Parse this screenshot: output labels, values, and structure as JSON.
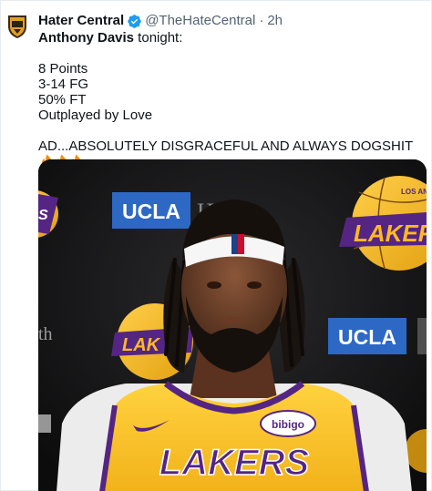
{
  "author": {
    "display_name": "Hater Central",
    "handle": "@TheHateCentral",
    "separator": "·",
    "time": "2h",
    "avatar_icon": "shield-crest-icon",
    "verified_icon": "verified-badge-icon"
  },
  "tweet": {
    "lead_bold": "Anthony Davis",
    "lead_rest": " tonight:",
    "stats": [
      "8 Points",
      "3-14 FG",
      "50% FT",
      "Outplayed by Love"
    ],
    "closing": "AD...ABSOLUTELY DISGRACEFUL AND ALWAYS DOGSHIT",
    "emoji_icons": [
      "fire-icon",
      "fire-icon",
      "fire-icon"
    ]
  },
  "media": {
    "ucla_top": "UCLA",
    "ucla_top_suffix": "Health",
    "ucla_right": "UCLA",
    "left_edge_letter": "th",
    "lakers_logo_text": "LAKERS",
    "lakers_logo_small": "LOS ANGELES",
    "jersey_text": "LAKERS",
    "sponsor_patch": "bibigo",
    "colors": {
      "lakers_gold": "#fdb927",
      "lakers_purple": "#552583",
      "ucla_blue": "#2d68c4",
      "verified_blue": "#1d9bf0"
    }
  }
}
